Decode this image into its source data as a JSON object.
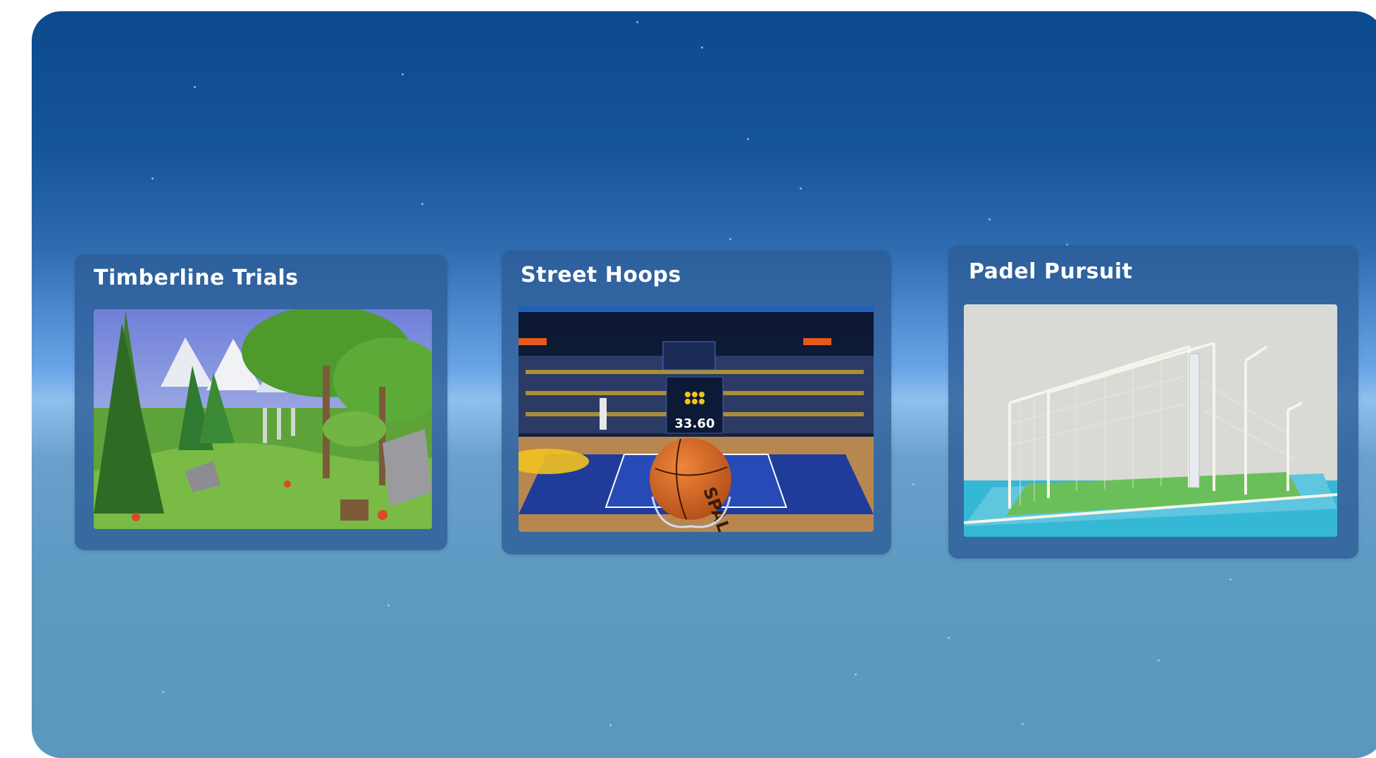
{
  "gallery": {
    "cards": [
      {
        "title": "Timberline Trials",
        "scene": "forest-scene-image"
      },
      {
        "title": "Street Hoops",
        "scene": "basketball-court-scene-image",
        "scoreboard_time": "33.60",
        "ball_brand": "SPAL"
      },
      {
        "title": "Padel Pursuit",
        "scene": "padel-court-scene-image"
      }
    ]
  },
  "colors": {
    "panel_top": "#0c4a8e",
    "panel_horizon": "#8fc0ee",
    "panel_bottom": "#5a98be",
    "card_bg": "#2c5c96"
  }
}
